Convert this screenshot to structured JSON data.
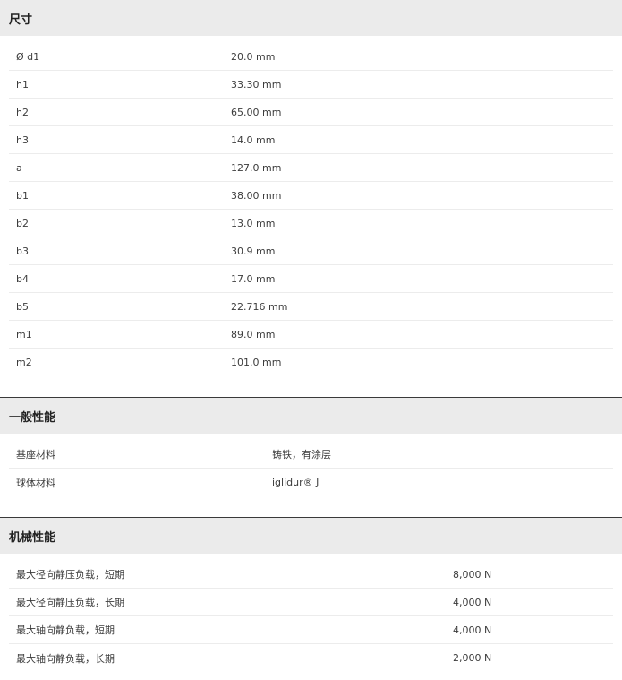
{
  "dimensions": {
    "title": "尺寸",
    "rows": [
      {
        "label": "Ø d1",
        "value": "20.0 mm"
      },
      {
        "label": "h1",
        "value": "33.30 mm"
      },
      {
        "label": "h2",
        "value": "65.00 mm"
      },
      {
        "label": "h3",
        "value": "14.0 mm"
      },
      {
        "label": "a",
        "value": "127.0 mm"
      },
      {
        "label": "b1",
        "value": "38.00 mm"
      },
      {
        "label": "b2",
        "value": "13.0 mm"
      },
      {
        "label": "b3",
        "value": "30.9 mm"
      },
      {
        "label": "b4",
        "value": "17.0 mm"
      },
      {
        "label": "b5",
        "value": "22.716 mm"
      },
      {
        "label": "m1",
        "value": "89.0 mm"
      },
      {
        "label": "m2",
        "value": "101.0 mm"
      }
    ]
  },
  "general": {
    "title": "一般性能",
    "rows": [
      {
        "label": "基座材料",
        "value": "铸铁，有涂层"
      },
      {
        "label": "球体材料",
        "value": "iglidur® J"
      }
    ]
  },
  "mechanical": {
    "title": "机械性能",
    "rows": [
      {
        "label": "最大径向静压负载，短期",
        "value": "8,000 N"
      },
      {
        "label": "最大径向静压负载，长期",
        "value": "4,000 N"
      },
      {
        "label": "最大轴向静负载，短期",
        "value": "4,000 N"
      },
      {
        "label": "最大轴向静负载，长期",
        "value": "2,000 N"
      }
    ]
  }
}
